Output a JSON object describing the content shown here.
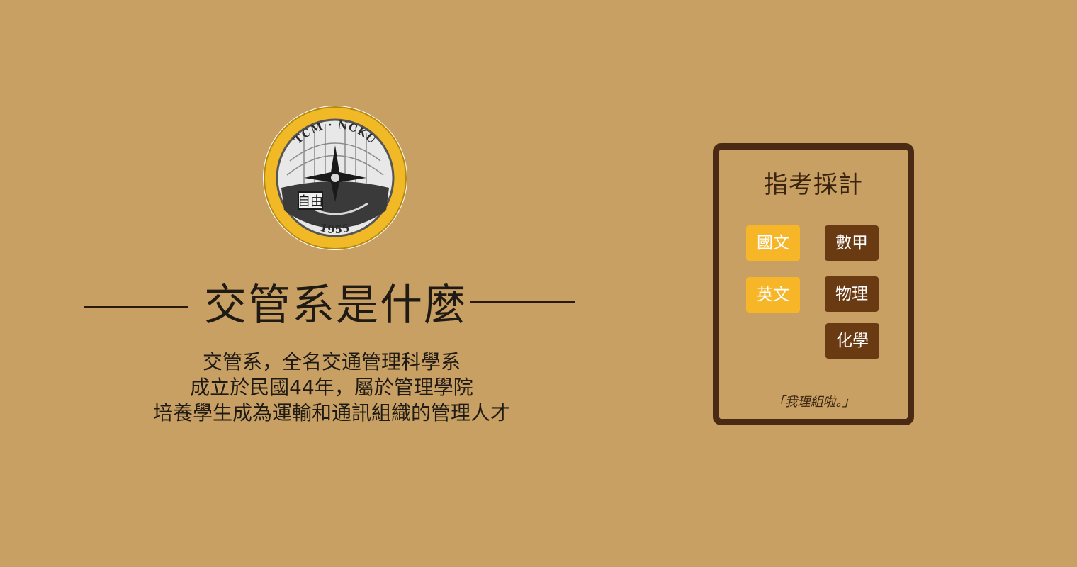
{
  "logo": {
    "top_text": "TCM · NCKU",
    "year_text": "· 1955 ·",
    "emblem_text": "自由",
    "icon": "airplane-emblem-icon"
  },
  "header": {
    "title": "交管系是什麼"
  },
  "description": {
    "lines": [
      "交管系，全名交通管理科學系",
      "成立於民國44年，屬於管理學院",
      "培養學生成為運輸和通訊組織的管理人才"
    ]
  },
  "card": {
    "title": "指考採計",
    "subjects": [
      {
        "label": "國文",
        "style": "yellow"
      },
      {
        "label": "數甲",
        "style": "brown"
      },
      {
        "label": "英文",
        "style": "yellow"
      },
      {
        "label": "物理",
        "style": "brown"
      },
      {
        "label": "化學",
        "style": "brown"
      }
    ],
    "quote": "「我理組啦。」"
  },
  "colors": {
    "background": "#c8a063",
    "card_border": "#4a2a14",
    "subject_yellow": "#f6b628",
    "subject_brown": "#6a3a12",
    "logo_ring": "#f2b927"
  }
}
